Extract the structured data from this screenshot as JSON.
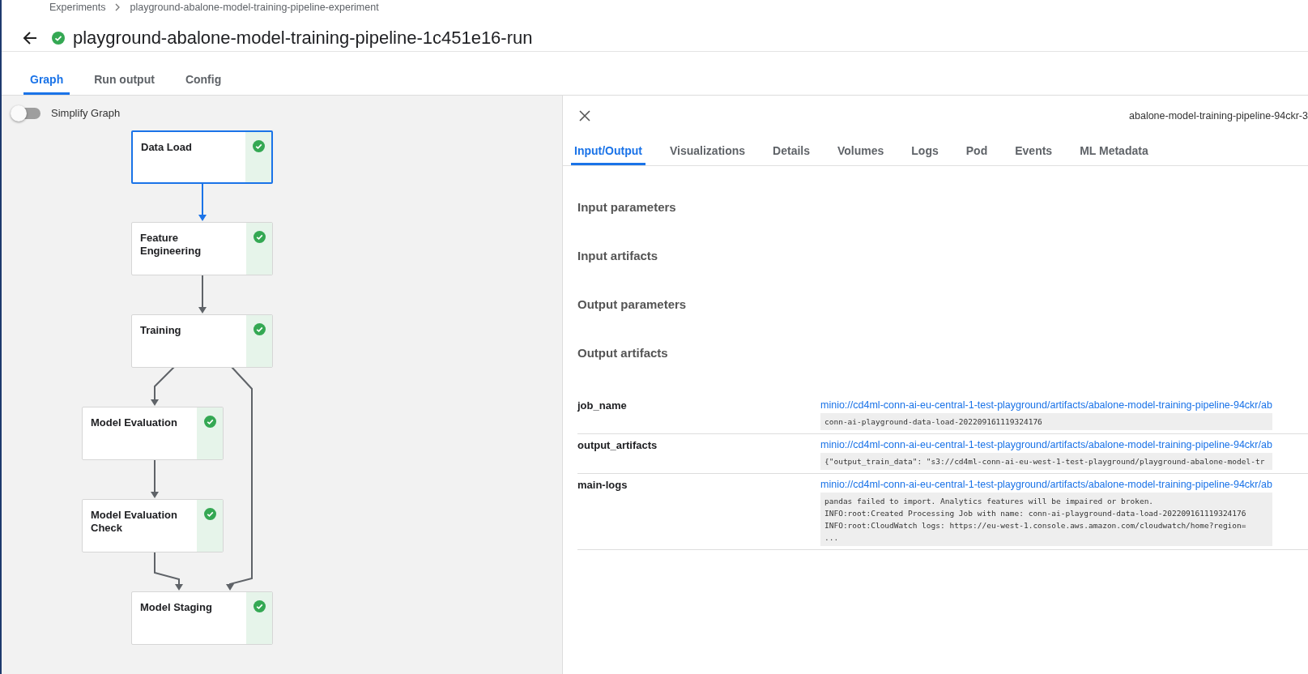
{
  "breadcrumbs": [
    "Experiments",
    "playground-abalone-model-training-pipeline-experiment"
  ],
  "title": {
    "text": "playground-abalone-model-training-pipeline-1c451e16-run",
    "succeeded": true
  },
  "tabs": [
    {
      "label": "Graph",
      "selected": true
    },
    {
      "label": "Run output",
      "selected": false
    },
    {
      "label": "Config",
      "selected": false
    }
  ],
  "simplify_graph": {
    "label": "Simplify Graph",
    "on": false
  },
  "nodes": [
    {
      "label": "Data Load",
      "succeeded": true,
      "selected": true
    },
    {
      "label": "Feature Engineering",
      "succeeded": true,
      "selected": false
    },
    {
      "label": "Training",
      "succeeded": true,
      "selected": false
    },
    {
      "label": "Model Evaluation",
      "succeeded": true,
      "selected": false
    },
    {
      "label": "Model Evaluation Check",
      "succeeded": true,
      "selected": false
    },
    {
      "label": "Model Staging",
      "succeeded": true,
      "selected": false
    }
  ],
  "side_panel": {
    "id": "abalone-model-training-pipeline-94ckr-3",
    "tabs": [
      {
        "label": "Input/Output",
        "selected": true
      },
      {
        "label": "Visualizations",
        "selected": false
      },
      {
        "label": "Details",
        "selected": false
      },
      {
        "label": "Volumes",
        "selected": false
      },
      {
        "label": "Logs",
        "selected": false
      },
      {
        "label": "Pod",
        "selected": false
      },
      {
        "label": "Events",
        "selected": false
      },
      {
        "label": "ML Metadata",
        "selected": false
      }
    ],
    "sections": [
      "Input parameters",
      "Input artifacts",
      "Output parameters",
      "Output artifacts"
    ],
    "output_artifacts": [
      {
        "name": "job_name",
        "link": "minio://cd4ml-conn-ai-eu-central-1-test-playground/artifacts/abalone-model-training-pipeline-94ckr/ab",
        "preview": [
          "conn-ai-playground-data-load-202209161119324176"
        ]
      },
      {
        "name": "output_artifacts",
        "link": "minio://cd4ml-conn-ai-eu-central-1-test-playground/artifacts/abalone-model-training-pipeline-94ckr/ab",
        "preview": [
          "{\"output_train_data\": \"s3://cd4ml-conn-ai-eu-west-1-test-playground/playground-abalone-model-tr"
        ]
      },
      {
        "name": "main-logs",
        "link": "minio://cd4ml-conn-ai-eu-central-1-test-playground/artifacts/abalone-model-training-pipeline-94ckr/ab",
        "preview": [
          "pandas failed to import. Analytics features will be impaired or broken.",
          "INFO:root:Created Processing Job with name: conn-ai-playground-data-load-202209161119324176",
          "INFO:root:CloudWatch logs: https://eu-west-1.console.aws.amazon.com/cloudwatch/home?region=",
          "..."
        ]
      }
    ]
  }
}
